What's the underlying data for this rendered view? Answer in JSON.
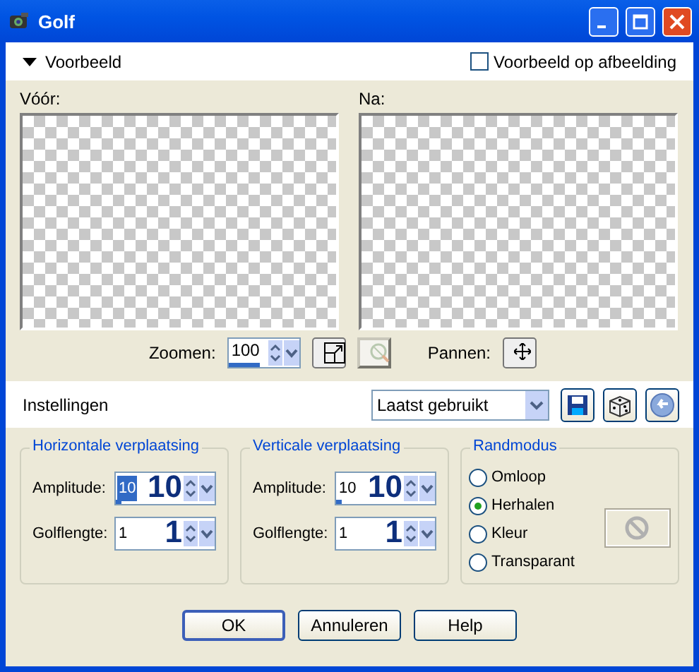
{
  "window": {
    "title": "Golf"
  },
  "preview": {
    "label": "Voorbeeld",
    "expanded": true,
    "on_image": {
      "label": "Voorbeeld op afbeelding",
      "checked": false
    },
    "before_label": "Vóór:",
    "after_label": "Na:",
    "zoom": {
      "label": "Zoomen:",
      "value": "100",
      "level": 0.45
    },
    "pan_label": "Pannen:"
  },
  "settings": {
    "label": "Instellingen",
    "preset": "Laatst gebruikt"
  },
  "groups": [
    {
      "title": "Horizontale verplaatsing",
      "fields": [
        {
          "label": "Amplitude:",
          "value": "10",
          "value_selected": true,
          "level": 0.05,
          "annotation": "10"
        },
        {
          "label": "Golflengte:",
          "value": "1",
          "value_selected": false,
          "annotation": "1"
        }
      ]
    },
    {
      "title": "Verticale verplaatsing",
      "fields": [
        {
          "label": "Amplitude:",
          "value": "10",
          "value_selected": false,
          "level": 0.05,
          "annotation": "10"
        },
        {
          "label": "Golflengte:",
          "value": "1",
          "value_selected": false,
          "annotation": "1"
        }
      ]
    }
  ],
  "edge_mode": {
    "title": "Randmodus",
    "options": [
      {
        "label": "Omloop",
        "selected": false
      },
      {
        "label": "Herhalen",
        "selected": true
      },
      {
        "label": "Kleur",
        "selected": false
      },
      {
        "label": "Transparant",
        "selected": false
      }
    ]
  },
  "buttons": [
    "OK",
    "Annuleren",
    "Help"
  ]
}
